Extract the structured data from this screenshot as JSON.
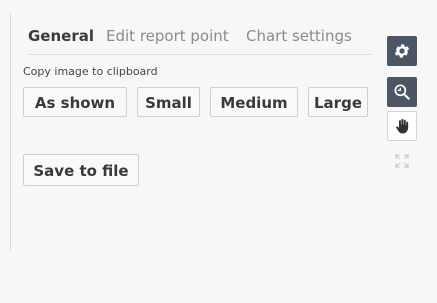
{
  "tabs": [
    {
      "label": "General",
      "active": true
    },
    {
      "label": "Edit report point",
      "active": false
    },
    {
      "label": "Chart settings",
      "active": false
    }
  ],
  "general": {
    "copy_caption": "Copy image to clipboard",
    "buttons": {
      "as_shown": "As shown",
      "small": "Small",
      "medium": "Medium",
      "large": "Large"
    },
    "save_to_file": "Save to file"
  },
  "toolbar": [
    {
      "icon": "gear-icon",
      "style": "dark"
    },
    {
      "icon": "zoom-icon",
      "style": "dark"
    },
    {
      "icon": "hand-pan-icon",
      "style": "light"
    },
    {
      "icon": "expand-icon",
      "style": "disabled"
    }
  ],
  "colors": {
    "background": "#f7f7f7",
    "text": "#3a3a3a",
    "muted_text": "#8a8a8a",
    "tool_dark": "#4b5563",
    "border": "#cfcfcf"
  }
}
